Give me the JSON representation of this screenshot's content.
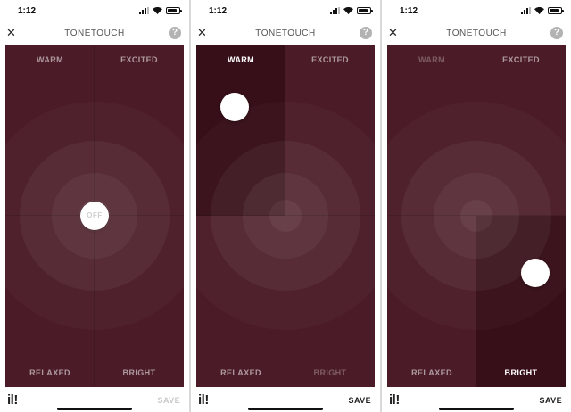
{
  "screens": [
    {
      "status_time": "1:12",
      "title": "TONETOUCH",
      "close_icon": "close-icon",
      "help_icon": "?",
      "labels": {
        "top_left": "WARM",
        "top_right": "EXCITED",
        "bottom_left": "RELAXED",
        "bottom_right": "BRIGHT"
      },
      "knob_text": "OFF",
      "selected_quadrant": "none",
      "logo": "il!",
      "save_label": "SAVE",
      "save_enabled": false
    },
    {
      "status_time": "1:12",
      "title": "TONETOUCH",
      "close_icon": "close-icon",
      "help_icon": "?",
      "labels": {
        "top_left": "WARM",
        "top_right": "EXCITED",
        "bottom_left": "RELAXED",
        "bottom_right": "BRIGHT"
      },
      "knob_text": "",
      "selected_quadrant": "warm",
      "logo": "il!",
      "save_label": "SAVE",
      "save_enabled": true
    },
    {
      "status_time": "1:12",
      "title": "TONETOUCH",
      "close_icon": "close-icon",
      "help_icon": "?",
      "labels": {
        "top_left": "WARM",
        "top_right": "EXCITED",
        "bottom_left": "RELAXED",
        "bottom_right": "BRIGHT"
      },
      "knob_text": "",
      "selected_quadrant": "bright",
      "logo": "il!",
      "save_label": "SAVE",
      "save_enabled": true
    }
  ],
  "colors": {
    "pad_background": "#4b1c27",
    "active_quadrant": "#370f18",
    "knob": "#ffffff",
    "save_disabled": "#c8c8c8"
  }
}
